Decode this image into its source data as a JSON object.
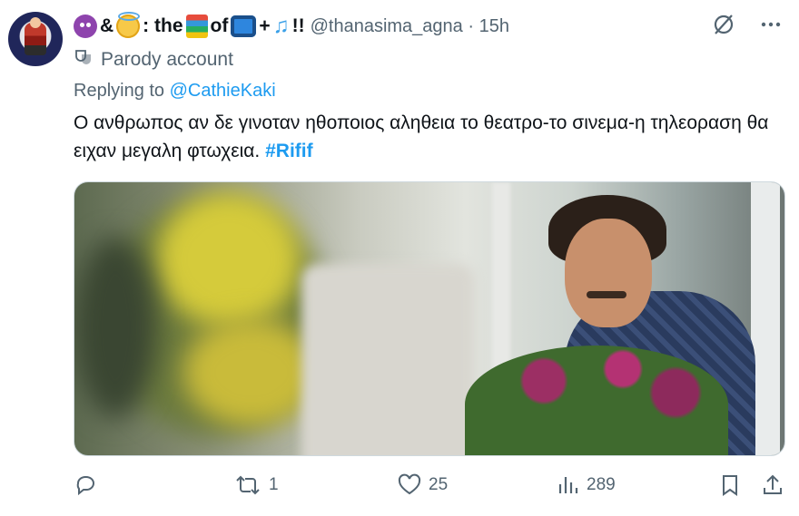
{
  "user": {
    "name_parts": [
      "&",
      ": the",
      "of",
      "+",
      "!!"
    ],
    "emojis": [
      "smiling-devil-emoji",
      "angel-emoji",
      "books-emoji",
      "tv-emoji",
      "music-notes-emoji"
    ],
    "handle": "@thanasima_agna",
    "separator": "·",
    "time": "15h",
    "parody_label": "Parody account"
  },
  "reply": {
    "prefix": "Replying to ",
    "mention": "@CathieKaki"
  },
  "tweet": {
    "text": "Ο ανθρωπος αν δε γινοταν ηθοποιος αληθεια το θεατρο-το σινεμα-η τηλεοραση θα ειχαν μεγαλη φτωχεια.",
    "hashtag": "#Rifif"
  },
  "stats": {
    "reply_count": "",
    "retweet_count": "1",
    "like_count": "25",
    "view_count": "289"
  },
  "colors": {
    "accent": "#1d9bf0",
    "secondary_text": "#536471",
    "primary_text": "#0f1419"
  }
}
